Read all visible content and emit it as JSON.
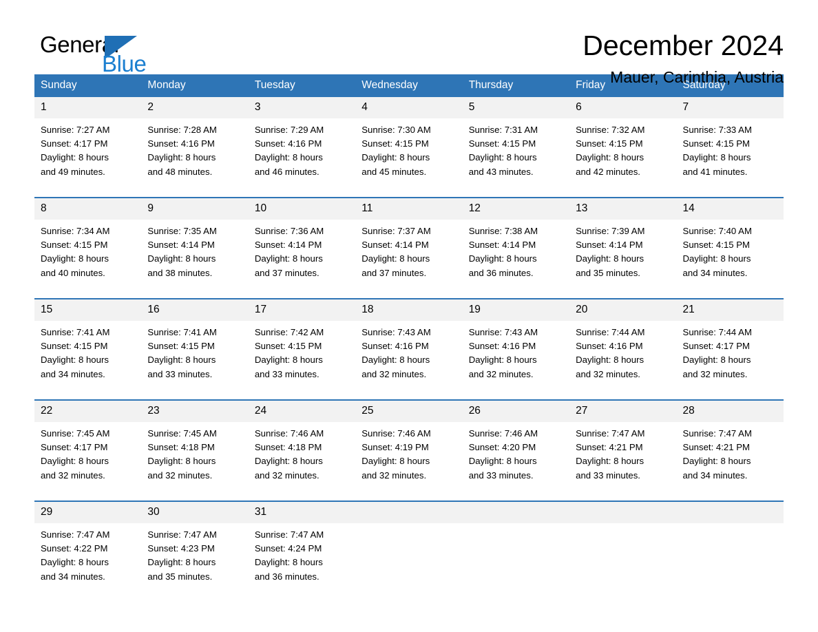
{
  "brand": {
    "line1": "General",
    "line2": "Blue",
    "triangle_color": "#1f6fb5"
  },
  "header": {
    "month_title": "December 2024",
    "location": "Mauer, Carinthia, Austria"
  },
  "colors": {
    "header_blue": "#2e75b6",
    "date_band": "#f2f2f2",
    "brand_blue": "#1b7fd0",
    "text": "#000000"
  },
  "weekday_headers": [
    "Sunday",
    "Monday",
    "Tuesday",
    "Wednesday",
    "Thursday",
    "Friday",
    "Saturday"
  ],
  "calendar_data": {
    "month": "December",
    "year": 2024,
    "location": "Mauer, Carinthia, Austria",
    "weeks": [
      [
        {
          "date": "1",
          "sunrise": "Sunrise: 7:27 AM",
          "sunset": "Sunset: 4:17 PM",
          "daylight_line1": "Daylight: 8 hours",
          "daylight_line2": "and 49 minutes."
        },
        {
          "date": "2",
          "sunrise": "Sunrise: 7:28 AM",
          "sunset": "Sunset: 4:16 PM",
          "daylight_line1": "Daylight: 8 hours",
          "daylight_line2": "and 48 minutes."
        },
        {
          "date": "3",
          "sunrise": "Sunrise: 7:29 AM",
          "sunset": "Sunset: 4:16 PM",
          "daylight_line1": "Daylight: 8 hours",
          "daylight_line2": "and 46 minutes."
        },
        {
          "date": "4",
          "sunrise": "Sunrise: 7:30 AM",
          "sunset": "Sunset: 4:15 PM",
          "daylight_line1": "Daylight: 8 hours",
          "daylight_line2": "and 45 minutes."
        },
        {
          "date": "5",
          "sunrise": "Sunrise: 7:31 AM",
          "sunset": "Sunset: 4:15 PM",
          "daylight_line1": "Daylight: 8 hours",
          "daylight_line2": "and 43 minutes."
        },
        {
          "date": "6",
          "sunrise": "Sunrise: 7:32 AM",
          "sunset": "Sunset: 4:15 PM",
          "daylight_line1": "Daylight: 8 hours",
          "daylight_line2": "and 42 minutes."
        },
        {
          "date": "7",
          "sunrise": "Sunrise: 7:33 AM",
          "sunset": "Sunset: 4:15 PM",
          "daylight_line1": "Daylight: 8 hours",
          "daylight_line2": "and 41 minutes."
        }
      ],
      [
        {
          "date": "8",
          "sunrise": "Sunrise: 7:34 AM",
          "sunset": "Sunset: 4:15 PM",
          "daylight_line1": "Daylight: 8 hours",
          "daylight_line2": "and 40 minutes."
        },
        {
          "date": "9",
          "sunrise": "Sunrise: 7:35 AM",
          "sunset": "Sunset: 4:14 PM",
          "daylight_line1": "Daylight: 8 hours",
          "daylight_line2": "and 38 minutes."
        },
        {
          "date": "10",
          "sunrise": "Sunrise: 7:36 AM",
          "sunset": "Sunset: 4:14 PM",
          "daylight_line1": "Daylight: 8 hours",
          "daylight_line2": "and 37 minutes."
        },
        {
          "date": "11",
          "sunrise": "Sunrise: 7:37 AM",
          "sunset": "Sunset: 4:14 PM",
          "daylight_line1": "Daylight: 8 hours",
          "daylight_line2": "and 37 minutes."
        },
        {
          "date": "12",
          "sunrise": "Sunrise: 7:38 AM",
          "sunset": "Sunset: 4:14 PM",
          "daylight_line1": "Daylight: 8 hours",
          "daylight_line2": "and 36 minutes."
        },
        {
          "date": "13",
          "sunrise": "Sunrise: 7:39 AM",
          "sunset": "Sunset: 4:14 PM",
          "daylight_line1": "Daylight: 8 hours",
          "daylight_line2": "and 35 minutes."
        },
        {
          "date": "14",
          "sunrise": "Sunrise: 7:40 AM",
          "sunset": "Sunset: 4:15 PM",
          "daylight_line1": "Daylight: 8 hours",
          "daylight_line2": "and 34 minutes."
        }
      ],
      [
        {
          "date": "15",
          "sunrise": "Sunrise: 7:41 AM",
          "sunset": "Sunset: 4:15 PM",
          "daylight_line1": "Daylight: 8 hours",
          "daylight_line2": "and 34 minutes."
        },
        {
          "date": "16",
          "sunrise": "Sunrise: 7:41 AM",
          "sunset": "Sunset: 4:15 PM",
          "daylight_line1": "Daylight: 8 hours",
          "daylight_line2": "and 33 minutes."
        },
        {
          "date": "17",
          "sunrise": "Sunrise: 7:42 AM",
          "sunset": "Sunset: 4:15 PM",
          "daylight_line1": "Daylight: 8 hours",
          "daylight_line2": "and 33 minutes."
        },
        {
          "date": "18",
          "sunrise": "Sunrise: 7:43 AM",
          "sunset": "Sunset: 4:16 PM",
          "daylight_line1": "Daylight: 8 hours",
          "daylight_line2": "and 32 minutes."
        },
        {
          "date": "19",
          "sunrise": "Sunrise: 7:43 AM",
          "sunset": "Sunset: 4:16 PM",
          "daylight_line1": "Daylight: 8 hours",
          "daylight_line2": "and 32 minutes."
        },
        {
          "date": "20",
          "sunrise": "Sunrise: 7:44 AM",
          "sunset": "Sunset: 4:16 PM",
          "daylight_line1": "Daylight: 8 hours",
          "daylight_line2": "and 32 minutes."
        },
        {
          "date": "21",
          "sunrise": "Sunrise: 7:44 AM",
          "sunset": "Sunset: 4:17 PM",
          "daylight_line1": "Daylight: 8 hours",
          "daylight_line2": "and 32 minutes."
        }
      ],
      [
        {
          "date": "22",
          "sunrise": "Sunrise: 7:45 AM",
          "sunset": "Sunset: 4:17 PM",
          "daylight_line1": "Daylight: 8 hours",
          "daylight_line2": "and 32 minutes."
        },
        {
          "date": "23",
          "sunrise": "Sunrise: 7:45 AM",
          "sunset": "Sunset: 4:18 PM",
          "daylight_line1": "Daylight: 8 hours",
          "daylight_line2": "and 32 minutes."
        },
        {
          "date": "24",
          "sunrise": "Sunrise: 7:46 AM",
          "sunset": "Sunset: 4:18 PM",
          "daylight_line1": "Daylight: 8 hours",
          "daylight_line2": "and 32 minutes."
        },
        {
          "date": "25",
          "sunrise": "Sunrise: 7:46 AM",
          "sunset": "Sunset: 4:19 PM",
          "daylight_line1": "Daylight: 8 hours",
          "daylight_line2": "and 32 minutes."
        },
        {
          "date": "26",
          "sunrise": "Sunrise: 7:46 AM",
          "sunset": "Sunset: 4:20 PM",
          "daylight_line1": "Daylight: 8 hours",
          "daylight_line2": "and 33 minutes."
        },
        {
          "date": "27",
          "sunrise": "Sunrise: 7:47 AM",
          "sunset": "Sunset: 4:21 PM",
          "daylight_line1": "Daylight: 8 hours",
          "daylight_line2": "and 33 minutes."
        },
        {
          "date": "28",
          "sunrise": "Sunrise: 7:47 AM",
          "sunset": "Sunset: 4:21 PM",
          "daylight_line1": "Daylight: 8 hours",
          "daylight_line2": "and 34 minutes."
        }
      ],
      [
        {
          "date": "29",
          "sunrise": "Sunrise: 7:47 AM",
          "sunset": "Sunset: 4:22 PM",
          "daylight_line1": "Daylight: 8 hours",
          "daylight_line2": "and 34 minutes."
        },
        {
          "date": "30",
          "sunrise": "Sunrise: 7:47 AM",
          "sunset": "Sunset: 4:23 PM",
          "daylight_line1": "Daylight: 8 hours",
          "daylight_line2": "and 35 minutes."
        },
        {
          "date": "31",
          "sunrise": "Sunrise: 7:47 AM",
          "sunset": "Sunset: 4:24 PM",
          "daylight_line1": "Daylight: 8 hours",
          "daylight_line2": "and 36 minutes."
        },
        {
          "date": "",
          "sunrise": "",
          "sunset": "",
          "daylight_line1": "",
          "daylight_line2": ""
        },
        {
          "date": "",
          "sunrise": "",
          "sunset": "",
          "daylight_line1": "",
          "daylight_line2": ""
        },
        {
          "date": "",
          "sunrise": "",
          "sunset": "",
          "daylight_line1": "",
          "daylight_line2": ""
        },
        {
          "date": "",
          "sunrise": "",
          "sunset": "",
          "daylight_line1": "",
          "daylight_line2": ""
        }
      ]
    ]
  }
}
